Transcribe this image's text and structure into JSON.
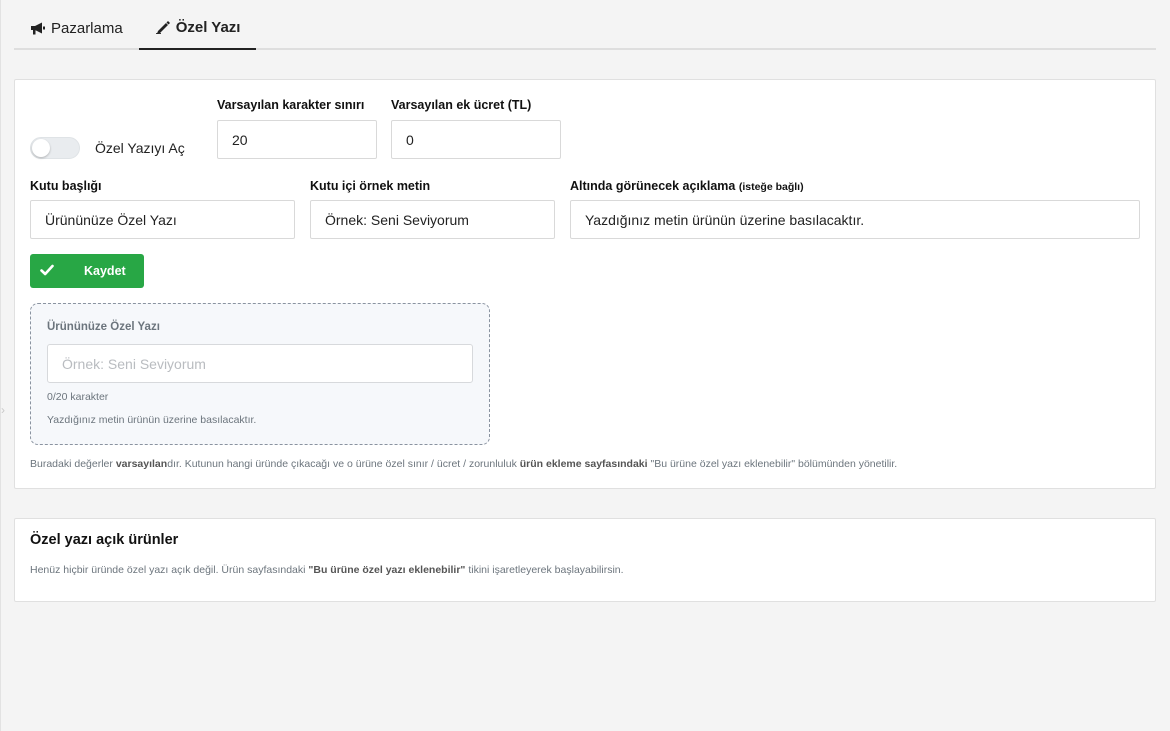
{
  "tabs": [
    {
      "label": "Pazarlama",
      "icon": "megaphone-icon",
      "active": false
    },
    {
      "label": "Özel Yazı",
      "icon": "pen-icon",
      "active": true
    }
  ],
  "settings": {
    "toggle_label": "Özel Yazıyı Aç",
    "toggle_on": false,
    "char_limit": {
      "label": "Varsayılan karakter sınırı",
      "value": "20"
    },
    "extra_fee": {
      "label": "Varsayılan ek ücret (TL)",
      "value": "0"
    },
    "box_title": {
      "label": "Kutu başlığı",
      "value": "Ürününüze Özel Yazı"
    },
    "sample_text": {
      "label": "Kutu içi örnek metin",
      "value": "Örnek: Seni Seviyorum"
    },
    "description": {
      "label": "Altında görünecek açıklama",
      "label_suffix": "(isteğe bağlı)",
      "value": "Yazdığınız metin ürünün üzerine basılacaktır."
    },
    "save_label": "Kaydet"
  },
  "preview": {
    "title": "Ürününüze Özel Yazı",
    "placeholder": "Örnek: Seni Seviyorum",
    "counter": "0/20 karakter",
    "help": "Yazdığınız metin ürünün üzerine basılacaktır."
  },
  "info_note": {
    "part1": "Buradaki değerler ",
    "bold1": "varsayılan",
    "part2": "dır. Kutunun hangi üründe çıkacağı ve o ürüne özel sınır / ücret / zorunluluk ",
    "bold2": "ürün ekleme sayfasındaki",
    "part3": " \"Bu ürüne özel yazı eklenebilir\" bölümünden yönetilir."
  },
  "products_card": {
    "title": "Özel yazı açık ürünler",
    "empty_part1": "Henüz hiçbir üründe özel yazı açık değil. Ürün sayfasındaki ",
    "empty_bold": "\"Bu ürüne özel yazı eklenebilir\"",
    "empty_part2": " tikini işaretleyerek başlayabilirsin."
  },
  "colors": {
    "accent_green": "#28a745",
    "page_bg": "#f4f4f4",
    "muted_text": "#6c757d"
  }
}
